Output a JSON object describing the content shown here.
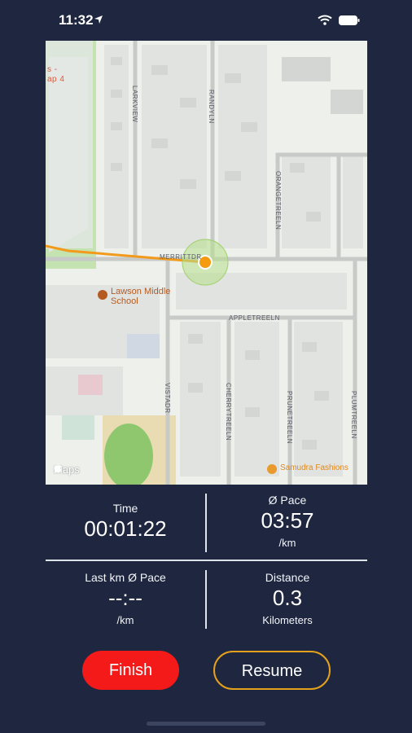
{
  "status_bar": {
    "time": "11:32"
  },
  "map": {
    "attribution": "Maps",
    "edge_label_1": "s -",
    "edge_label_2": "ap 4",
    "streets": {
      "larkview": "LARKVIEW",
      "randy": "RANDYLN",
      "orange_tree": "ORANGETREELN",
      "merritt": "MERRITTDR",
      "apple_tree": "APPLETREELN",
      "vista": "VISTADR",
      "cherry_tree": "CHERRYTREELN",
      "prune_tree": "PRUNETREELN",
      "plum_tree": "PLUMTREELN"
    },
    "pois": {
      "school_line1": "Lawson Middle",
      "school_line2": "School",
      "shop": "Samudra Fashions"
    },
    "colors": {
      "route": "#f29a1c",
      "location": "#f49b10",
      "accuracy": "#b6e08a"
    }
  },
  "stats": {
    "time": {
      "label": "Time",
      "value": "00:01:22"
    },
    "avg_pace": {
      "label": "Ø Pace",
      "value": "03:57",
      "unit": "/km"
    },
    "last_km_pace": {
      "label": "Last km Ø Pace",
      "value": "--:--",
      "unit": "/km"
    },
    "distance": {
      "label": "Distance",
      "value": "0.3",
      "unit": "Kilometers"
    }
  },
  "buttons": {
    "finish": "Finish",
    "resume": "Resume"
  },
  "colors": {
    "background": "#1f2740",
    "finish": "#f41a1a",
    "resume_border": "#e4a11b"
  }
}
